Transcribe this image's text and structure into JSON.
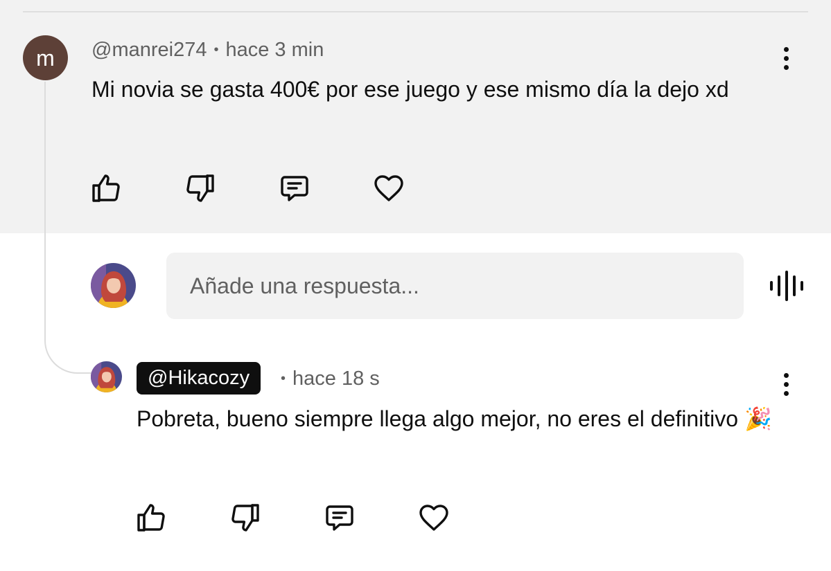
{
  "comment": {
    "avatar_letter": "m",
    "author": "@manrei274",
    "separator": "•",
    "time": "hace 3 min",
    "text": "Mi novia se gasta 400€ por ese juego y ese mismo día la dejo xd",
    "menu_icon": "more-vert-icon",
    "actions": [
      {
        "name": "like",
        "icon": "thumb-up-icon"
      },
      {
        "name": "dislike",
        "icon": "thumb-down-icon"
      },
      {
        "name": "reply",
        "icon": "comment-icon"
      },
      {
        "name": "heart",
        "icon": "heart-icon"
      }
    ]
  },
  "reply_box": {
    "placeholder": "Añade una respuesta...",
    "voice_icon": "voice-waveform-icon"
  },
  "reply": {
    "author": "@Hikacozy",
    "separator": "•",
    "time": "hace 18 s",
    "text": "Pobreta, bueno siempre llega algo mejor, no eres el definitivo 🎉",
    "menu_icon": "more-vert-icon"
  },
  "colors": {
    "panel_bg": "#f2f2f2",
    "text": "#0f0f0f",
    "secondary_text": "#606060",
    "avatar_bg": "#5d4037",
    "badge_bg": "#0f0f0f"
  }
}
